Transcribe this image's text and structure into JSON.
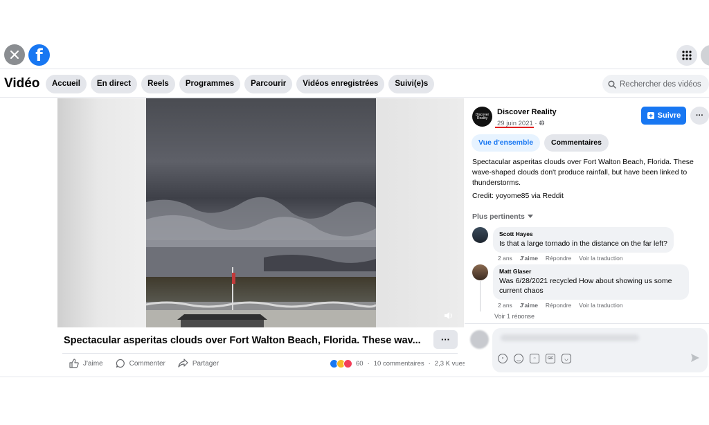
{
  "topbar": {
    "close_icon": "close-icon",
    "logo": "facebook-logo",
    "apps_icon": "grid-menu-icon"
  },
  "nav": {
    "title": "Vidéo",
    "tabs": [
      {
        "label": "Accueil"
      },
      {
        "label": "En direct"
      },
      {
        "label": "Reels"
      },
      {
        "label": "Programmes"
      },
      {
        "label": "Parcourir"
      },
      {
        "label": "Vidéos enregistrées"
      },
      {
        "label": "Suivi(e)s"
      }
    ],
    "search_placeholder": "Rechercher des vidéos"
  },
  "video": {
    "caption": "Spectacular asperitas clouds over Fort Walton Beach, Florida. These wav...",
    "more_label": "···",
    "actions": {
      "like": "J'aime",
      "comment": "Commenter",
      "share": "Partager"
    },
    "stats": {
      "reaction_count": "60",
      "separator": "·",
      "comments": "10 commentaires",
      "views": "2,3 K vues"
    }
  },
  "panel": {
    "page_name": "Discover Reality",
    "avatar_text": "Discover Reality",
    "date": "29 juin 2021",
    "date_separator": "·",
    "follow_label": "Suivre",
    "more_label": "···",
    "tabs": {
      "overview": "Vue d'ensemble",
      "comments": "Commentaires"
    },
    "description": "Spectacular asperitas clouds over Fort Walton Beach, Florida. These wave-shaped clouds don't produce rainfall, but have been linked to thunderstorms.",
    "credit": "Credit: yoyome85 via Reddit",
    "sort_label": "Plus pertinents",
    "comments": [
      {
        "author": "Scott Hayes",
        "text": "Is that a large tornado in the distance on the far left?",
        "time": "2 ans",
        "like": "J'aime",
        "reply": "Répondre",
        "translate": "Voir la traduction"
      },
      {
        "author": "Matt Glaser",
        "text": "Was 6/28/2021 recycled How about showing us some current chaos",
        "time": "2 ans",
        "like": "J'aime",
        "reply": "Répondre",
        "translate": "Voir la traduction"
      }
    ],
    "more_replies": "Voir 1 réponse"
  },
  "colors": {
    "accent": "#1877f2",
    "date_underline": "#e02020"
  }
}
